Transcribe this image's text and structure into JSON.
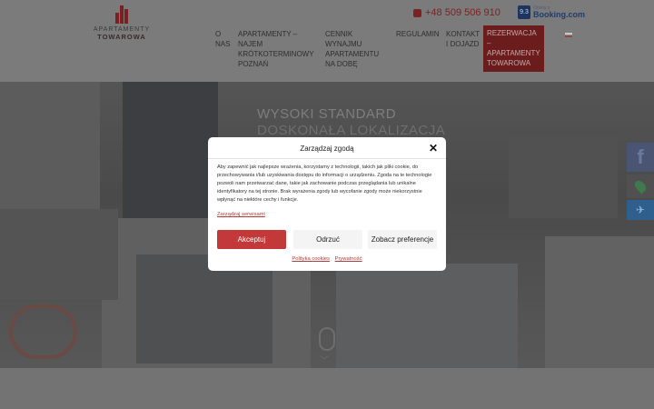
{
  "header": {
    "logo_line1": "APARTAMENTY",
    "logo_line2": "TOWAROWA",
    "phone": "+48 509 506 910",
    "booking_score": "9.3",
    "booking_small": "Oceny z",
    "booking_brand": "Booking.com"
  },
  "nav": {
    "items": [
      {
        "label": "O\nNAS"
      },
      {
        "label": "APARTAMENTY –\nNAJEM\nKRÓTKOTERMINOWY\nPOZNAŃ"
      },
      {
        "label": "CENNIK\nWYNAJMU\nAPARTAMENTU\nNA DOBĘ"
      },
      {
        "label": "REGULAMIN"
      },
      {
        "label": "KONTAKT\nI DOJAZD"
      },
      {
        "label": "REZERWACJA –\nAPARTAMENTY\nTOWAROWA"
      }
    ]
  },
  "hero": {
    "title": "WYSOKI STANDARD",
    "subtitle": "DOSKONAŁA LOKALIZACJA"
  },
  "social": {
    "facebook": "f",
    "maps": "",
    "twitter": "✈"
  },
  "cookie_modal": {
    "title": "Zarządzaj zgodą",
    "body": "Aby zapewnić jak najlepsze wrażenia, korzystamy z technologii, takich jak pliki cookie, do przechowywania i/lub uzyskiwania dostępu do informacji o urządzeniu. Zgoda na te technologie pozwoli nam przetwarzać dane, takie jak zachowanie podczas przeglądania lub unikalne identyfikatory na tej stronie. Brak wyrażenia zgody lub wycofanie zgody może niekorzystnie wpłynąć na niektóre cechy i funkcje.",
    "manage_link": "Zarządzaj serwisami",
    "accept": "Akceptuj",
    "deny": "Odrzuć",
    "preferences": "Zobacz preferencje",
    "cookie_policy": "Polityka cookies",
    "privacy": "Prywatność"
  },
  "colors": {
    "accent": "#c33838",
    "header_overlay": "#7b7b7b",
    "cta": "#6b1c1c"
  }
}
